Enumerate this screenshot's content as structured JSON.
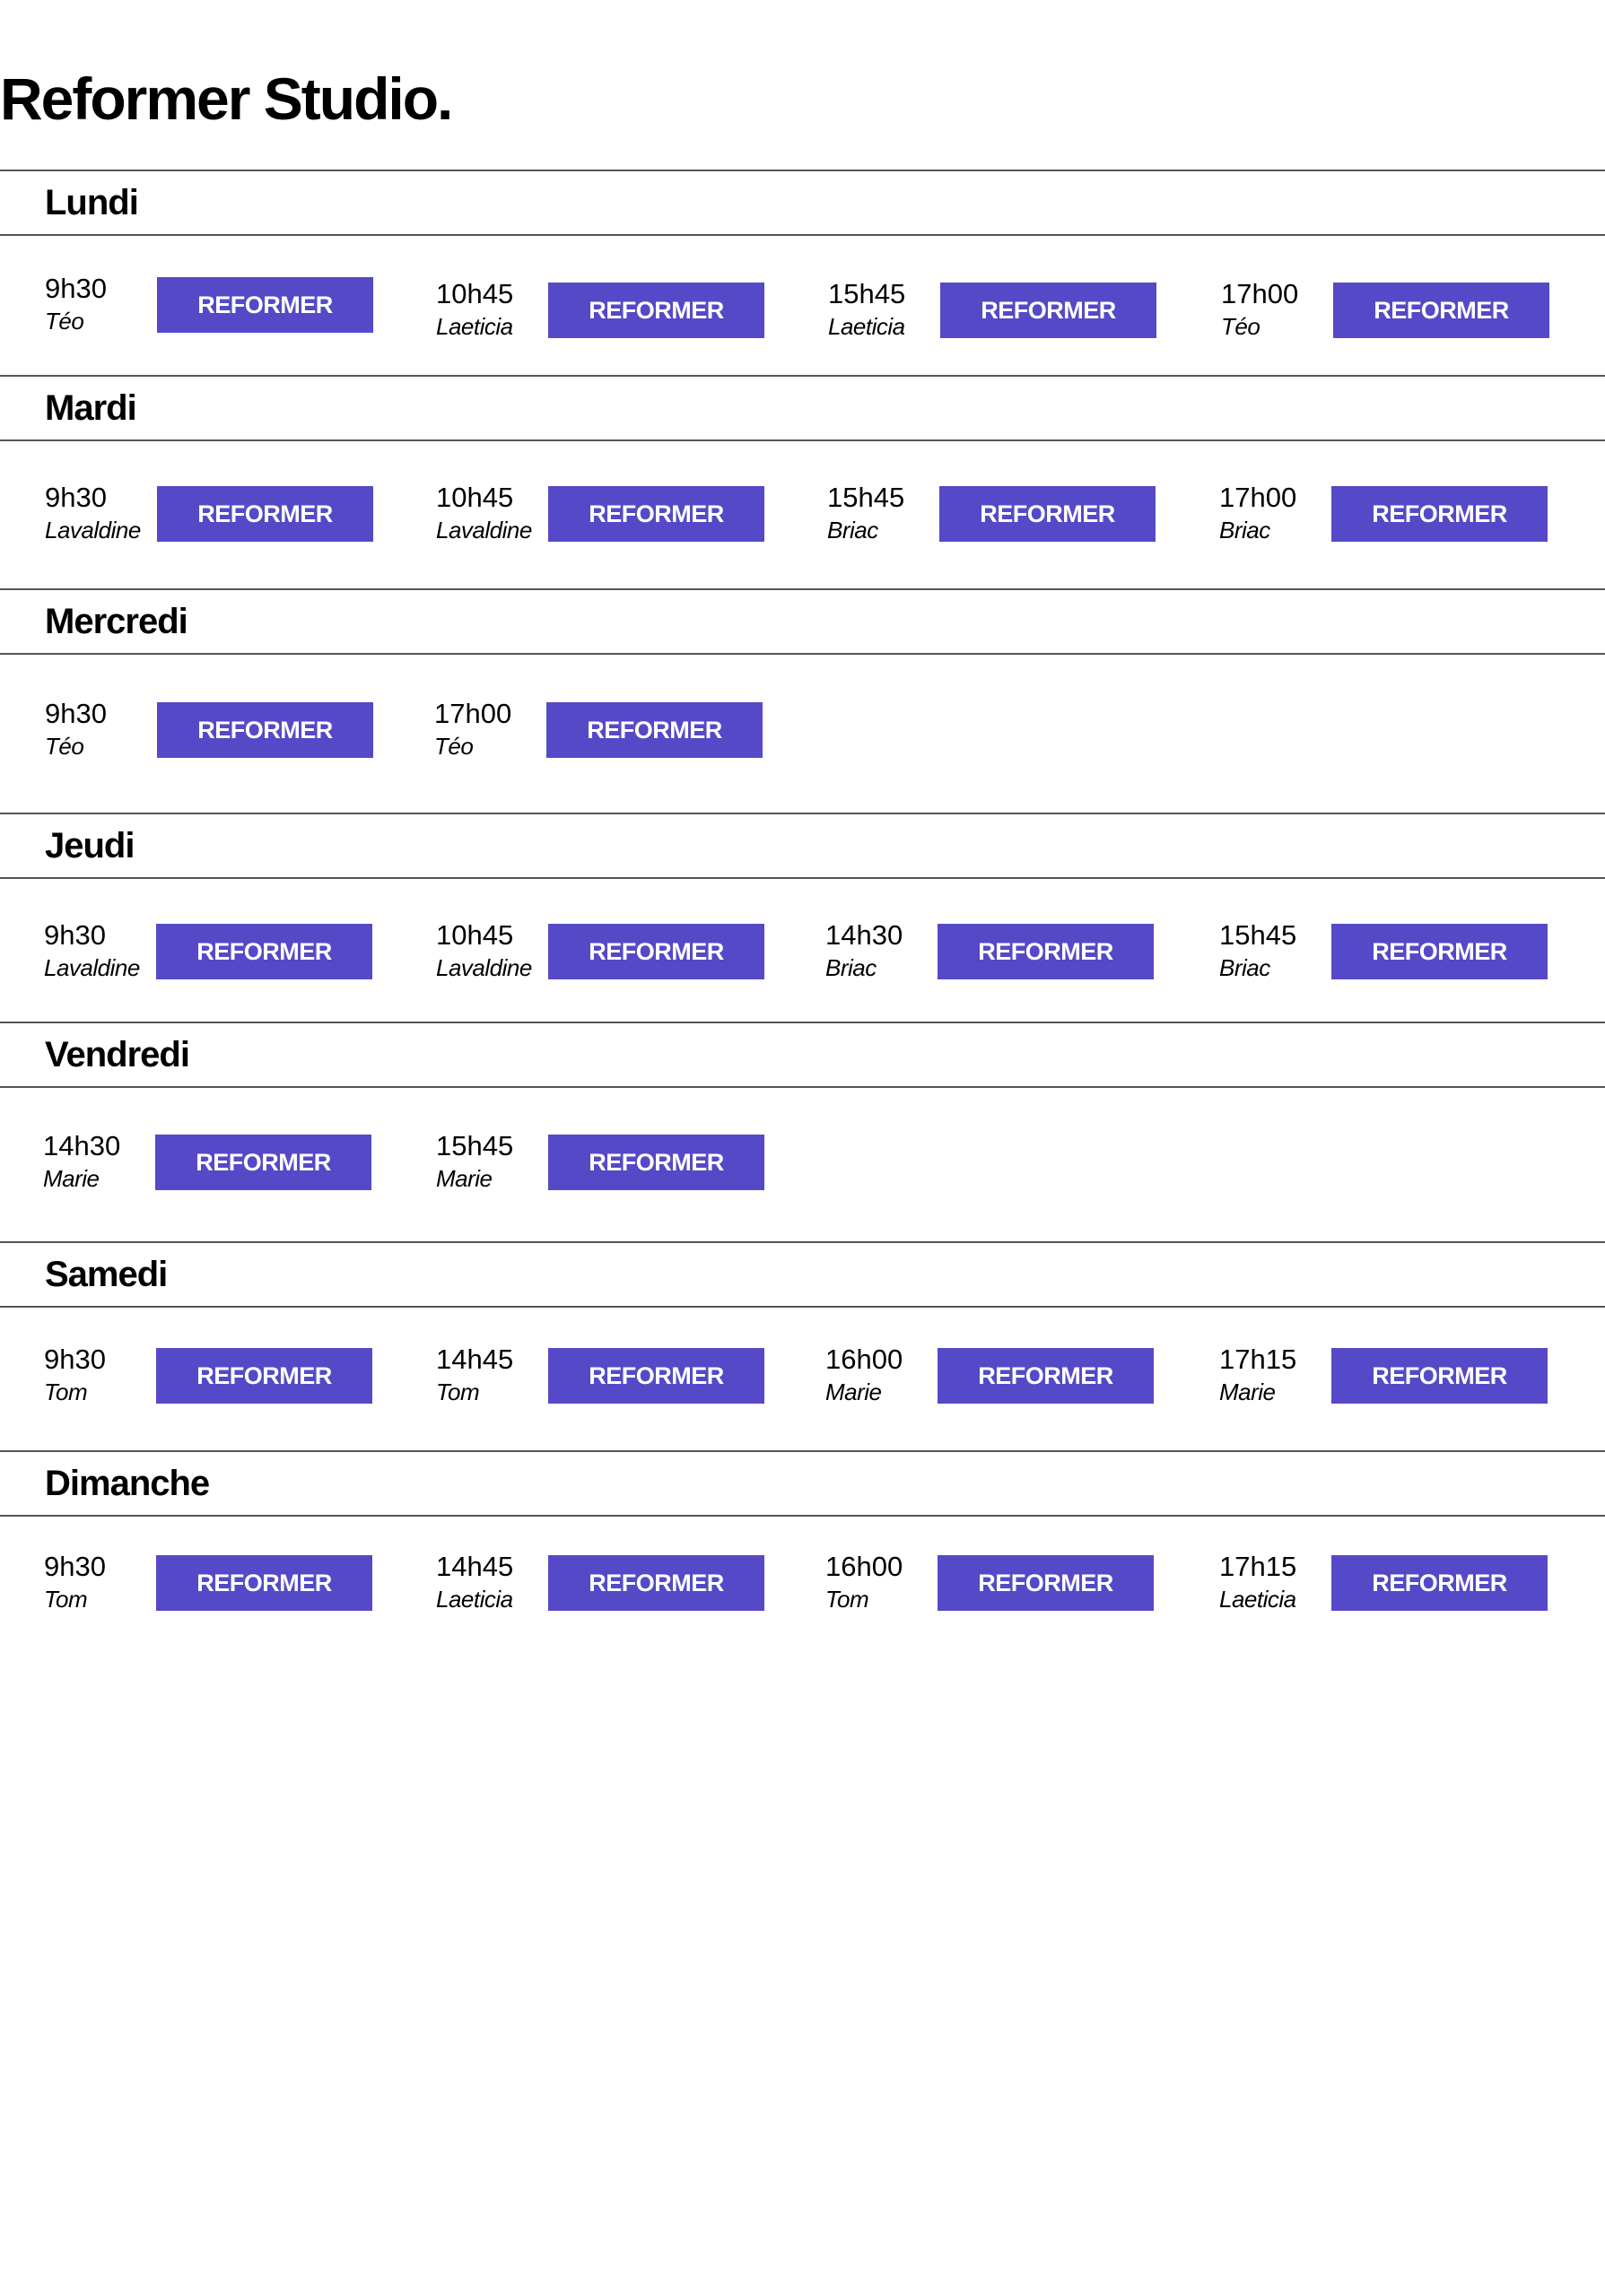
{
  "page": {
    "title": "Reformer Studio."
  },
  "colors": {
    "button_bg": "#5549c8",
    "button_text": "#ffffff",
    "rule": "#555555"
  },
  "days": [
    {
      "name": "Lundi",
      "slots": [
        {
          "time": "9h30",
          "coach": "Téo",
          "button": "REFORMER"
        },
        {
          "time": "10h45",
          "coach": "Laeticia",
          "button": "REFORMER"
        },
        {
          "time": "15h45",
          "coach": "Laeticia",
          "button": "REFORMER"
        },
        {
          "time": "17h00",
          "coach": "Téo",
          "button": "REFORMER"
        }
      ]
    },
    {
      "name": "Mardi",
      "slots": [
        {
          "time": "9h30",
          "coach": "Lavaldine",
          "button": "REFORMER"
        },
        {
          "time": "10h45",
          "coach": "Lavaldine",
          "button": "REFORMER"
        },
        {
          "time": "15h45",
          "coach": "Briac",
          "button": "REFORMER"
        },
        {
          "time": "17h00",
          "coach": "Briac",
          "button": "REFORMER"
        }
      ]
    },
    {
      "name": "Mercredi",
      "slots": [
        {
          "time": "9h30",
          "coach": "Téo",
          "button": "REFORMER"
        },
        {
          "time": "17h00",
          "coach": "Téo",
          "button": "REFORMER"
        }
      ]
    },
    {
      "name": "Jeudi",
      "slots": [
        {
          "time": "9h30",
          "coach": "Lavaldine",
          "button": "REFORMER"
        },
        {
          "time": "10h45",
          "coach": "Lavaldine",
          "button": "REFORMER"
        },
        {
          "time": "14h30",
          "coach": "Briac",
          "button": "REFORMER"
        },
        {
          "time": "15h45",
          "coach": "Briac",
          "button": "REFORMER"
        }
      ]
    },
    {
      "name": "Vendredi",
      "slots": [
        {
          "time": "14h30",
          "coach": "Marie",
          "button": "REFORMER"
        },
        {
          "time": "15h45",
          "coach": "Marie",
          "button": "REFORMER"
        }
      ]
    },
    {
      "name": "Samedi",
      "slots": [
        {
          "time": "9h30",
          "coach": "Tom",
          "button": "REFORMER"
        },
        {
          "time": "14h45",
          "coach": "Tom",
          "button": "REFORMER"
        },
        {
          "time": "16h00",
          "coach": "Marie",
          "button": "REFORMER"
        },
        {
          "time": "17h15",
          "coach": "Marie",
          "button": "REFORMER"
        }
      ]
    },
    {
      "name": "Dimanche",
      "slots": [
        {
          "time": "9h30",
          "coach": "Tom",
          "button": "REFORMER"
        },
        {
          "time": "14h45",
          "coach": "Laeticia",
          "button": "REFORMER"
        },
        {
          "time": "16h00",
          "coach": "Tom",
          "button": "REFORMER"
        },
        {
          "time": "17h15",
          "coach": "Laeticia",
          "button": "REFORMER"
        }
      ]
    }
  ]
}
